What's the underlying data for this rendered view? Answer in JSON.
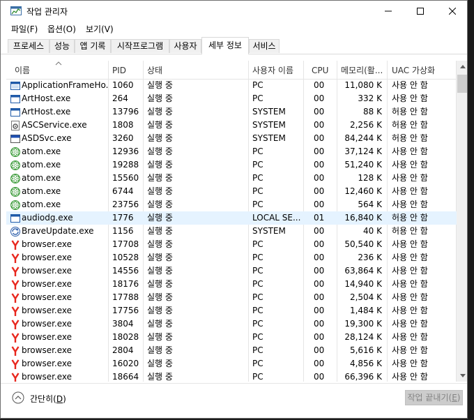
{
  "window": {
    "title": "작업 관리자"
  },
  "menu": [
    "파일(F)",
    "옵션(O)",
    "보기(V)"
  ],
  "tabs": [
    "프로세스",
    "성능",
    "앱 기록",
    "시작프로그램",
    "사용자",
    "세부 정보",
    "서비스"
  ],
  "active_tab": "세부 정보",
  "columns": [
    "이름",
    "PID",
    "상태",
    "사용자 이름",
    "CPU",
    "메모리(활...",
    "UAC 가상화"
  ],
  "rows": [
    {
      "icon": "app-frame-icon",
      "name": "ApplicationFrameHo...",
      "pid": "1060",
      "status": "실행 중",
      "user": "PC",
      "cpu": "00",
      "mem": "11,080 K",
      "uac": "사용 안 함"
    },
    {
      "icon": "window-app-icon",
      "name": "ArtHost.exe",
      "pid": "264",
      "status": "실행 중",
      "user": "PC",
      "cpu": "00",
      "mem": "332 K",
      "uac": "사용 안 함"
    },
    {
      "icon": "window-app-icon",
      "name": "ArtHost.exe",
      "pid": "13796",
      "status": "실행 중",
      "user": "SYSTEM",
      "cpu": "00",
      "mem": "88 K",
      "uac": "허용 안 함"
    },
    {
      "icon": "service-gear-icon",
      "name": "ASCService.exe",
      "pid": "1808",
      "status": "실행 중",
      "user": "SYSTEM",
      "cpu": "00",
      "mem": "2,256 K",
      "uac": "허용 안 함"
    },
    {
      "icon": "asds-icon",
      "name": "ASDSvc.exe",
      "pid": "3260",
      "status": "실행 중",
      "user": "SYSTEM",
      "cpu": "00",
      "mem": "84,244 K",
      "uac": "허용 안 함"
    },
    {
      "icon": "atom-icon",
      "name": "atom.exe",
      "pid": "12936",
      "status": "실행 중",
      "user": "PC",
      "cpu": "00",
      "mem": "37,124 K",
      "uac": "사용 안 함"
    },
    {
      "icon": "atom-icon",
      "name": "atom.exe",
      "pid": "19288",
      "status": "실행 중",
      "user": "PC",
      "cpu": "00",
      "mem": "51,240 K",
      "uac": "사용 안 함"
    },
    {
      "icon": "atom-icon",
      "name": "atom.exe",
      "pid": "15560",
      "status": "실행 중",
      "user": "PC",
      "cpu": "00",
      "mem": "128 K",
      "uac": "사용 안 함"
    },
    {
      "icon": "atom-icon",
      "name": "atom.exe",
      "pid": "6744",
      "status": "실행 중",
      "user": "PC",
      "cpu": "00",
      "mem": "12,460 K",
      "uac": "사용 안 함"
    },
    {
      "icon": "atom-icon",
      "name": "atom.exe",
      "pid": "23756",
      "status": "실행 중",
      "user": "PC",
      "cpu": "00",
      "mem": "564 K",
      "uac": "사용 안 함"
    },
    {
      "icon": "window-app-icon",
      "name": "audiodg.exe",
      "pid": "1776",
      "status": "실행 중",
      "user": "LOCAL SE...",
      "cpu": "01",
      "mem": "16,840 K",
      "uac": "허용 안 함",
      "selected": true
    },
    {
      "icon": "brave-update-icon",
      "name": "BraveUpdate.exe",
      "pid": "1156",
      "status": "실행 중",
      "user": "SYSTEM",
      "cpu": "00",
      "mem": "40 K",
      "uac": "허용 안 함"
    },
    {
      "icon": "yandex-browser-icon",
      "name": "browser.exe",
      "pid": "17708",
      "status": "실행 중",
      "user": "PC",
      "cpu": "00",
      "mem": "50,540 K",
      "uac": "사용 안 함"
    },
    {
      "icon": "yandex-browser-icon",
      "name": "browser.exe",
      "pid": "10528",
      "status": "실행 중",
      "user": "PC",
      "cpu": "00",
      "mem": "236 K",
      "uac": "사용 안 함"
    },
    {
      "icon": "yandex-browser-icon",
      "name": "browser.exe",
      "pid": "14556",
      "status": "실행 중",
      "user": "PC",
      "cpu": "00",
      "mem": "63,864 K",
      "uac": "사용 안 함"
    },
    {
      "icon": "yandex-browser-icon",
      "name": "browser.exe",
      "pid": "18176",
      "status": "실행 중",
      "user": "PC",
      "cpu": "00",
      "mem": "14,940 K",
      "uac": "사용 안 함"
    },
    {
      "icon": "yandex-browser-icon",
      "name": "browser.exe",
      "pid": "17788",
      "status": "실행 중",
      "user": "PC",
      "cpu": "00",
      "mem": "2,504 K",
      "uac": "사용 안 함"
    },
    {
      "icon": "yandex-browser-icon",
      "name": "browser.exe",
      "pid": "17756",
      "status": "실행 중",
      "user": "PC",
      "cpu": "00",
      "mem": "1,484 K",
      "uac": "사용 안 함"
    },
    {
      "icon": "yandex-browser-icon",
      "name": "browser.exe",
      "pid": "3804",
      "status": "실행 중",
      "user": "PC",
      "cpu": "00",
      "mem": "19,300 K",
      "uac": "사용 안 함"
    },
    {
      "icon": "yandex-browser-icon",
      "name": "browser.exe",
      "pid": "18028",
      "status": "실행 중",
      "user": "PC",
      "cpu": "00",
      "mem": "28,124 K",
      "uac": "사용 안 함"
    },
    {
      "icon": "yandex-browser-icon",
      "name": "browser.exe",
      "pid": "2804",
      "status": "실행 중",
      "user": "PC",
      "cpu": "00",
      "mem": "5,616 K",
      "uac": "사용 안 함"
    },
    {
      "icon": "yandex-browser-icon",
      "name": "browser.exe",
      "pid": "16020",
      "status": "실행 중",
      "user": "PC",
      "cpu": "00",
      "mem": "4,856 K",
      "uac": "사용 안 함"
    },
    {
      "icon": "yandex-browser-icon",
      "name": "browser.exe",
      "pid": "18664",
      "status": "실행 중",
      "user": "PC",
      "cpu": "00",
      "mem": "66,396 K",
      "uac": "사용 안 함"
    }
  ],
  "footer": {
    "collapse_label_prefix": "간단히(",
    "collapse_key": "D",
    "collapse_label_suffix": ")",
    "endtask_prefix": "작업 끝내기(",
    "endtask_key": "E",
    "endtask_suffix": ")"
  },
  "colors": {
    "selected_row": "#e5f3ff",
    "atom_green": "#45a043",
    "yandex_red": "#e8261d",
    "disabled_button": "#cccccc"
  }
}
